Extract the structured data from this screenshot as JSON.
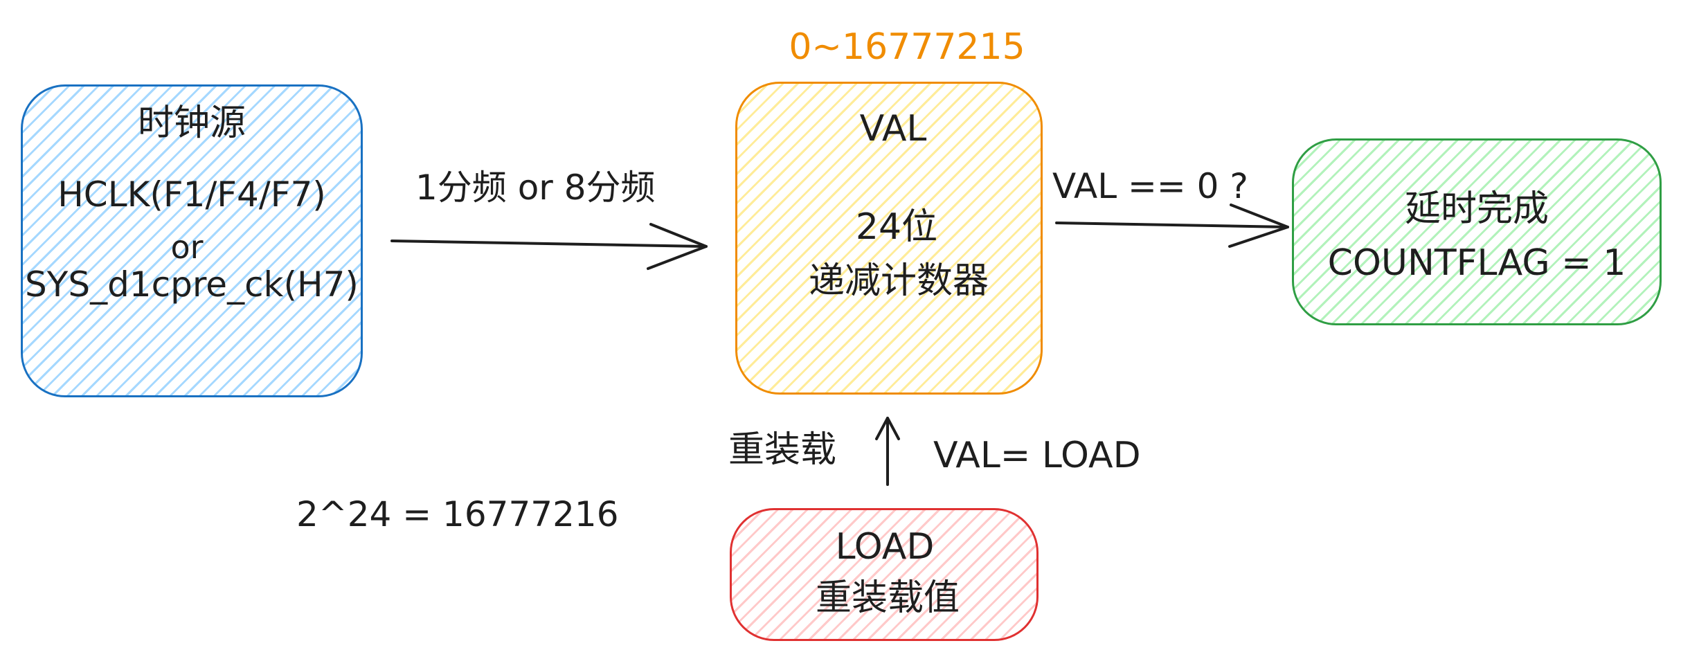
{
  "clock_box": {
    "title": "时钟源",
    "line1": "HCLK(F1/F4/F7)",
    "line2": "or",
    "line3": "SYS_d1cpre_ck(H7)"
  },
  "prescaler_label": "1分频 or 8分频",
  "range_label": "0~16777215",
  "val_box": {
    "title": "VAL",
    "line1": "24位",
    "line2": "递减计数器"
  },
  "condition_label": "VAL == 0 ?",
  "done_box": {
    "line1": "延时完成",
    "line2": "COUNTFLAG = 1"
  },
  "reload_label": "重装载",
  "reload_assign_label": "VAL= LOAD",
  "max_count_label": "2^24 = 16777216",
  "load_box": {
    "line1": "LOAD",
    "line2": "重装载值"
  },
  "colors": {
    "clock_stroke": "#1971c2",
    "clock_fill": "#a5d8ff",
    "val_stroke": "#f08c00",
    "val_fill": "#ffec99",
    "done_stroke": "#2f9e44",
    "done_fill": "#b2f2bb",
    "load_stroke": "#e03131",
    "load_fill": "#ffc9c9",
    "range_text": "#f08c00",
    "ink": "#1e1e1e"
  }
}
